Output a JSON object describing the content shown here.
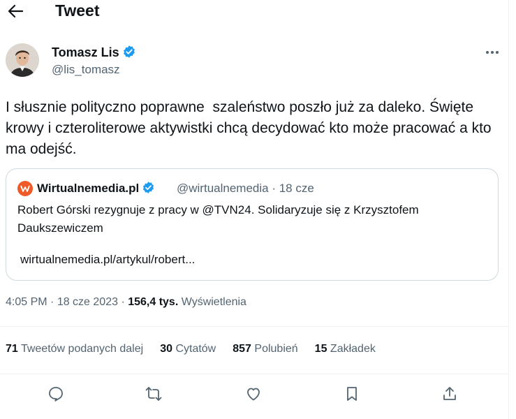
{
  "header": {
    "title": "Tweet"
  },
  "author": {
    "name": "Tomasz Lis",
    "handle": "@lis_tomasz"
  },
  "tweet": {
    "text": "I słusznie polityczno poprawne  szaleństwo poszło już za daleko. Święte krowy i czteroliterowe aktywistki chcą decydować kto może pracować a kto ma odejść."
  },
  "quote": {
    "name": "Wirtualnemedia.pl",
    "handle_time": "@wirtualnemedia · 18 cze",
    "text": "Robert Górski rezygnuje z pracy w @TVN24. Solidaryzuje się z Krzysztofem Daukszewiczem",
    "link": "wirtualnemedia.pl/artykul/robert..."
  },
  "meta": {
    "time": "4:05 PM",
    "date": "18 cze 2023",
    "views_count": "156,4 tys.",
    "views_label": "Wyświetlenia"
  },
  "stats": {
    "retweets_count": "71",
    "retweets_label": "Tweetów podanych dalej",
    "quotes_count": "30",
    "quotes_label": "Cytatów",
    "likes_count": "857",
    "likes_label": "Polubień",
    "bookmarks_count": "15",
    "bookmarks_label": "Zakładek"
  },
  "icons": {
    "back": "arrow-left-icon",
    "verified": "verified-badge-icon",
    "more": "more-icon",
    "reply": "reply-icon",
    "retweet": "retweet-icon",
    "like": "heart-icon",
    "bookmark": "bookmark-icon",
    "share": "share-icon"
  },
  "colors": {
    "verified": "#1d9bf0",
    "quote_logo": "#f05a28",
    "muted": "#536471",
    "text": "#0f1419"
  }
}
